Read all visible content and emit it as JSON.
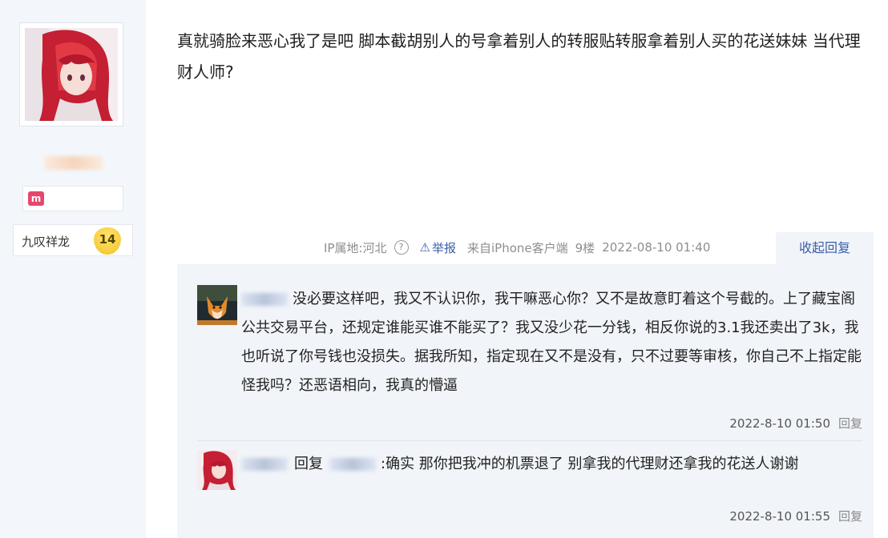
{
  "user": {
    "level_title": "九叹祥龙",
    "level_number": "14"
  },
  "post": {
    "text": "真就骑脸来恶心我了是吧 脚本截胡别人的号拿着别人的转服贴转服拿着别人买的花送妹妹 当代理财人师?",
    "meta": {
      "ip": "IP属地:河北",
      "help_symbol": "?",
      "report_icon": "warning-triangle-icon",
      "report": "举报",
      "source": "来自iPhone客户端",
      "floor": "9楼",
      "timestamp": "2022-08-10 01:40"
    },
    "collapse_reply": "收起回复"
  },
  "replies": [
    {
      "text": "没必要这样吧，我又不认识你，我干嘛恶心你？又不是故意盯着这个号截的。上了藏宝阁公共交易平台，还规定谁能买谁不能买了？我又没少花一分钱，相反你说的3.1我还卖出了3k，我也听说了你号钱也没损失。据我所知，指定现在又不是没有，只不过要等审核，你自己不上指定能怪我吗？还恶语相向，我真的懵逼",
      "timestamp": "2022-8-10 01:50",
      "reply_label": "回复"
    },
    {
      "reply_word": "回复",
      "text": ":确实 那你把我冲的机票退了 别拿我的代理财还拿我的花送人谢谢",
      "timestamp": "2022-8-10 01:55",
      "reply_label": "回复"
    }
  ],
  "colors": {
    "link_blue": "#3b5ea8",
    "reply_bg": "#f1f4f9",
    "badge_pink": "#e6476b",
    "level_gold": "#f3c223"
  }
}
